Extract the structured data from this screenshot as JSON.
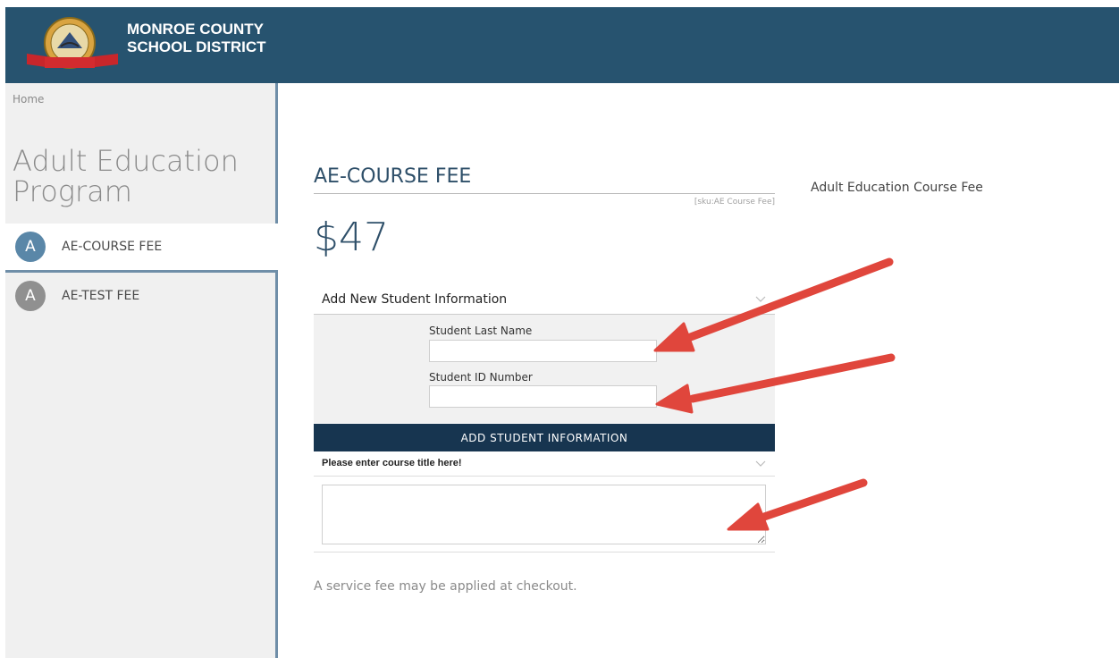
{
  "header": {
    "district_line1": "MONROE COUNTY",
    "district_line2": "SCHOOL DISTRICT",
    "logo_icon": "district-seal-icon",
    "background_color": "#27536f"
  },
  "sidebar": {
    "breadcrumb": "Home",
    "program_title_line1": "Adult Education",
    "program_title_line2": "Program",
    "items": [
      {
        "initial": "A",
        "label": "AE-COURSE FEE",
        "active": true,
        "circle_color": "#5a87a8"
      },
      {
        "initial": "A",
        "label": "AE-TEST FEE",
        "active": false,
        "circle_color": "#909090"
      }
    ]
  },
  "product": {
    "title": "AE-COURSE FEE",
    "sku": "[sku:AE Course Fee]",
    "price": "$47",
    "description": "Adult Education Course Fee",
    "service_note": "A service fee may be applied at checkout."
  },
  "student_form": {
    "section_title": "Add New Student Information",
    "last_name_label": "Student Last Name",
    "last_name_value": "",
    "id_label": "Student ID Number",
    "id_value": "",
    "submit_label": "ADD STUDENT INFORMATION"
  },
  "course": {
    "prompt": "Please enter course title here!",
    "value": ""
  },
  "colors": {
    "accent_dark": "#173550",
    "title_blue": "#2e4f69",
    "annotation_arrow": "#e0463c"
  }
}
